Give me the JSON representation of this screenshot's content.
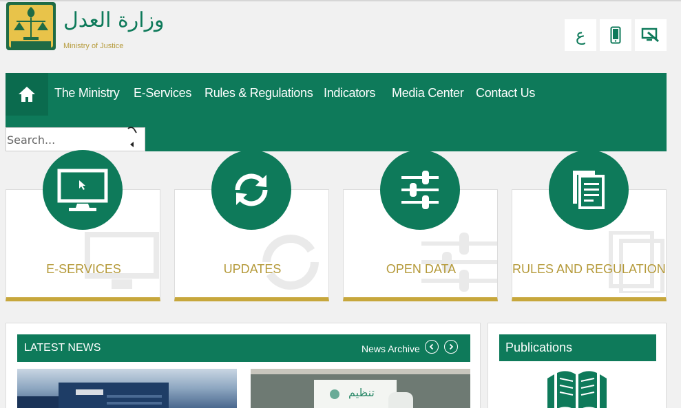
{
  "header": {
    "ministry_name_ar": "وزارة العدل",
    "ministry_name_en": "Ministry of Justice",
    "language_button": "ع",
    "icons": {
      "logo": "ministry-emblem",
      "mobile": "mobile-phone-icon",
      "reader": "screen-reader-icon"
    }
  },
  "nav": {
    "items": [
      {
        "label": "The Ministry"
      },
      {
        "label": "E-Services"
      },
      {
        "label": "Rules & Regulations"
      },
      {
        "label": "Indicators"
      },
      {
        "label": "Media Center"
      },
      {
        "label": "Contact Us"
      }
    ],
    "home_icon": "home-icon",
    "search": {
      "placeholder": "Search..."
    }
  },
  "cards": [
    {
      "label": "E-SERVICES",
      "icon": "monitor-icon"
    },
    {
      "label": "UPDATES",
      "icon": "refresh-icon"
    },
    {
      "label": "OPEN DATA",
      "icon": "sliders-icon"
    },
    {
      "label": "RULES AND REGULATIONS",
      "icon": "documents-icon"
    }
  ],
  "news": {
    "title": "LATEST NEWS",
    "archive_label": "News Archive",
    "image_two_caption": "تنظيم"
  },
  "publications": {
    "title": "Publications",
    "icon": "open-book-icon"
  },
  "colors": {
    "primary_green": "#0e7a5a",
    "gold": "#c7a73c",
    "gold_text": "#b59a3a",
    "background": "#f1f1f1"
  }
}
